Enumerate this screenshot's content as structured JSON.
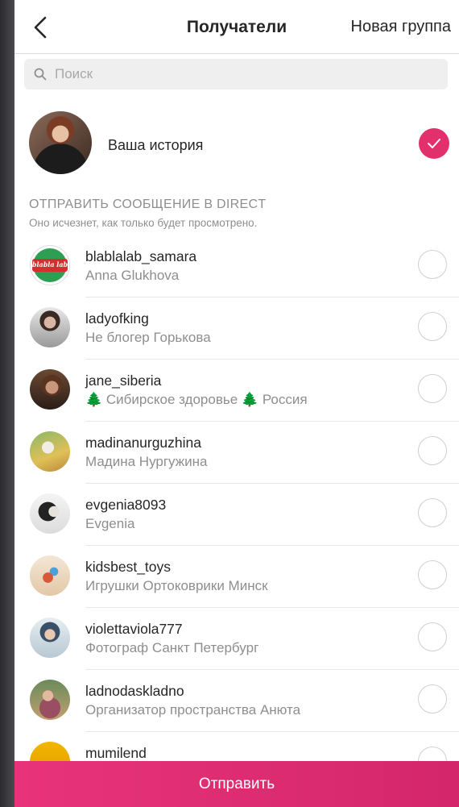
{
  "header": {
    "title": "Получатели",
    "new_group": "Новая группа"
  },
  "search": {
    "placeholder": "Поиск",
    "value": ""
  },
  "story": {
    "label": "Ваша история",
    "selected": true
  },
  "direct": {
    "title": "ОТПРАВИТЬ СООБЩЕНИЕ В DIRECT",
    "subtitle": "Оно исчезнет, как только будет просмотрено."
  },
  "recipients": [
    {
      "username": "blablalab_samara",
      "full_name": "Anna Glukhova",
      "avatar_text": "blabla lab"
    },
    {
      "username": "ladyofking",
      "full_name": "Не блогер Горькова"
    },
    {
      "username": "jane_siberia",
      "full_name": "Сибирское здоровье",
      "full_name_suffix": "Россия"
    },
    {
      "username": "madinanurguzhina",
      "full_name": "Мадина Нургужина"
    },
    {
      "username": "evgenia8093",
      "full_name": "Evgenia"
    },
    {
      "username": "kidsbest_toys",
      "full_name": "Игрушки Ортоковрики Минск"
    },
    {
      "username": "violettaviola777",
      "full_name": "Фотограф Санкт Петербург"
    },
    {
      "username": "ladnodaskladno",
      "full_name": "Организатор пространства Анюта"
    },
    {
      "username": "mumilend",
      "full_name": ""
    }
  ],
  "send_button": "Отправить",
  "colors": {
    "accent": "#e1306c",
    "send_gradient_start": "#e8337a",
    "send_gradient_end": "#d4266b"
  },
  "icons": {
    "back": "chevron-left-icon",
    "search": "search-icon",
    "check": "check-icon",
    "tree": "tree-emoji"
  }
}
